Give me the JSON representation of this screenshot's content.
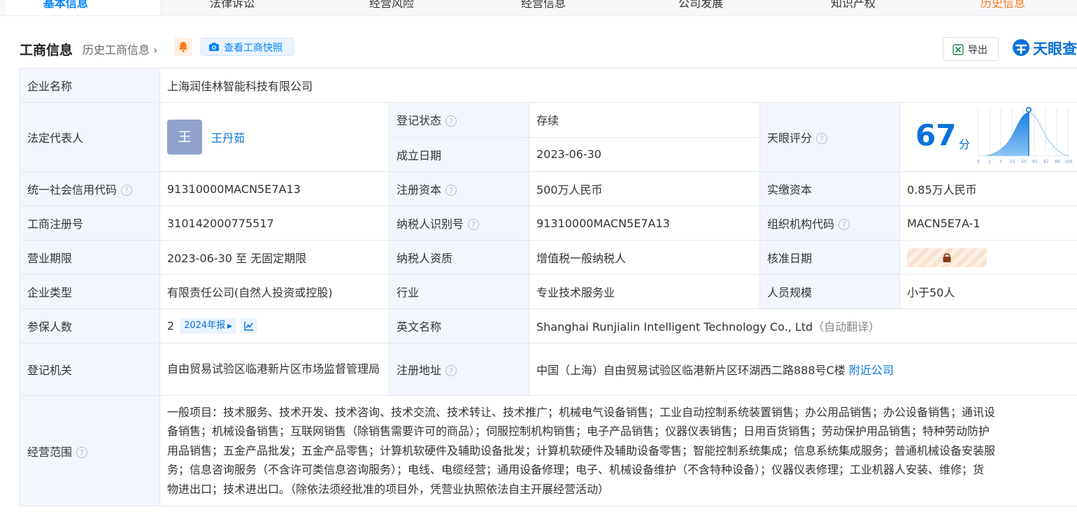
{
  "top_nav": {
    "tabs": [
      {
        "label": "基本信息"
      },
      {
        "label": "法律诉讼"
      },
      {
        "label": "经营风险"
      },
      {
        "label": "经营信息"
      },
      {
        "label": "公司发展"
      },
      {
        "label": "知识产权"
      },
      {
        "label": "历史信息"
      }
    ]
  },
  "header": {
    "title": "工商信息",
    "history_link": "历史工商信息",
    "snapshot_button": "查看工商快照",
    "export_button": "导出",
    "logo_text": "天眼查"
  },
  "info": {
    "company_name": {
      "label": "企业名称",
      "value": "上海润佳林智能科技有限公司"
    },
    "legal_rep": {
      "label": "法定代表人",
      "avatar_char": "王",
      "name": "王丹茹"
    },
    "reg_status": {
      "label": "登记状态",
      "value": "存续"
    },
    "founded": {
      "label": "成立日期",
      "value": "2023-06-30"
    },
    "tianyan_score": {
      "label": "天眼评分",
      "value": "67",
      "unit": "分",
      "axis_ticks": [
        "0",
        "1",
        "3",
        "15",
        "50",
        "85",
        "97",
        "99",
        "100"
      ]
    },
    "credit_code": {
      "label": "统一社会信用代码",
      "value": "91310000MACN5E7A13"
    },
    "reg_capital": {
      "label": "注册资本",
      "value": "500万人民币"
    },
    "paid_capital": {
      "label": "实缴资本",
      "value": "0.85万人民币"
    },
    "biz_reg_no": {
      "label": "工商注册号",
      "value": "310142000775517"
    },
    "taxpayer_id": {
      "label": "纳税人识别号",
      "value": "91310000MACN5E7A13"
    },
    "org_code": {
      "label": "组织机构代码",
      "value": "MACN5E7A-1"
    },
    "term": {
      "label": "营业期限",
      "value": "2023-06-30 至 无固定期限"
    },
    "taxpayer_type": {
      "label": "纳税人资质",
      "value": "增值税一般纳税人"
    },
    "approval_date": {
      "label": "核准日期"
    },
    "company_type": {
      "label": "企业类型",
      "value": "有限责任公司(自然人投资或控股)"
    },
    "industry": {
      "label": "行业",
      "value": "专业技术服务业"
    },
    "staff_size": {
      "label": "人员规模",
      "value": "小于50人"
    },
    "insured": {
      "label": "参保人数",
      "value": "2",
      "year_badge": "2024年报"
    },
    "english_name": {
      "label": "英文名称",
      "value": "Shanghai Runjialin Intelligent Technology Co., Ltd",
      "note": "（自动翻译）"
    },
    "reg_authority": {
      "label": "登记机关",
      "value": "自由贸易试验区临港新片区市场监督管理局"
    },
    "reg_address": {
      "label": "注册地址",
      "value": "中国（上海）自由贸易试验区临港新片区环湖西二路888号C楼",
      "link": "附近公司"
    },
    "scope": {
      "label": "经营范围",
      "lines": [
        "一般项目：技术服务、技术开发、技术咨询、技术交流、技术转让、技术推广；机械电气设备销售；工业自动控制系统装置销售；办公用品销售；办公设备销售；通讯设",
        "备销售；机械设备销售；互联网销售（除销售需要许可的商品）；伺服控制机构销售；电子产品销售；仪器仪表销售；日用百货销售；劳动保护用品销售；特种劳动防护",
        "用品销售；五金产品批发；五金产品零售；计算机软硬件及辅助设备批发；计算机软硬件及辅助设备零售；智能控制系统集成；信息系统集成服务；普通机械设备安装服",
        "务；信息咨询服务（不含许可类信息咨询服务）；电线、电缆经营；通用设备修理；电子、机械设备维护（不含特种设备）；仪器仪表修理；工业机器人安装、维修；货",
        "物进出口；技术进出口。（除依法须经批准的项目外，凭营业执照依法自主开展经营活动）"
      ]
    }
  },
  "colors": {
    "accent": "#0a71d9",
    "status_green": "#27a844",
    "label_bg": "#f3f7fd",
    "border": "#e4e7ed"
  }
}
